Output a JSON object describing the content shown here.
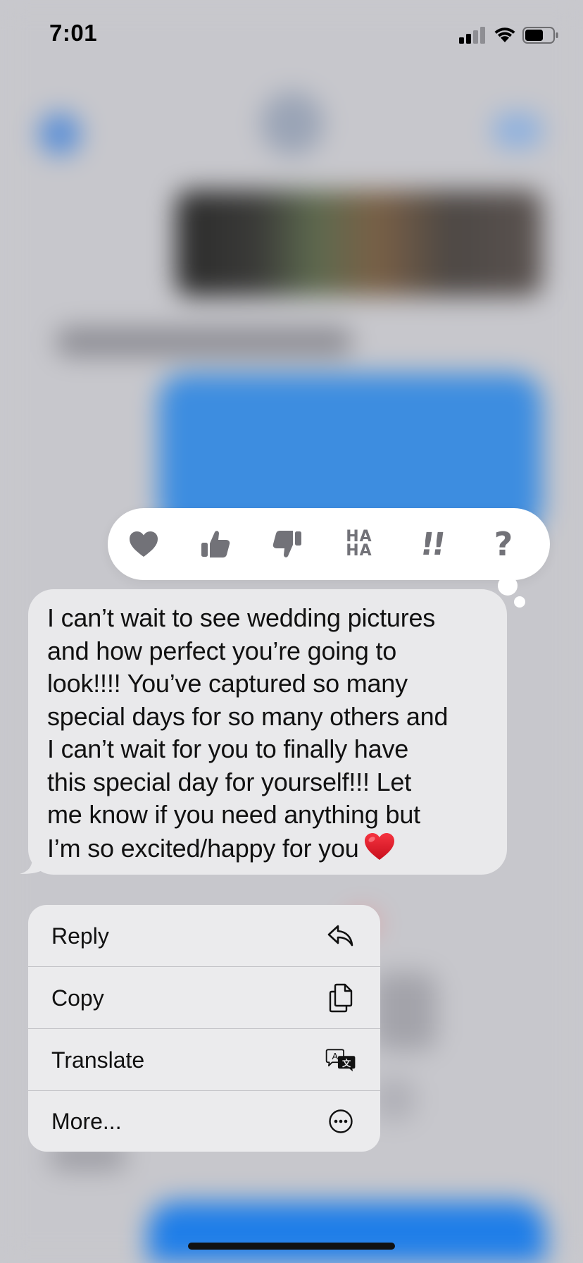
{
  "status_bar": {
    "time": "7:01",
    "signal_icon": "cellular-signal-icon",
    "wifi_icon": "wifi-icon",
    "battery_icon": "battery-icon"
  },
  "tapbacks": [
    {
      "name": "heart",
      "icon": "heart-icon"
    },
    {
      "name": "thumbs-up",
      "icon": "thumbs-up-icon"
    },
    {
      "name": "thumbs-down",
      "icon": "thumbs-down-icon"
    },
    {
      "name": "haha",
      "text": "HA\nHA"
    },
    {
      "name": "exclamation",
      "text": "!!"
    },
    {
      "name": "question",
      "text": "?"
    }
  ],
  "message": {
    "text": "I can’t wait to see wedding pictures\nand how perfect you’re going to\nlook!!!! You’ve captured so many\nspecial days for so many others and\nI can’t wait for you to finally have\nthis special day for yourself!!! Let\nme know if you need anything but\nI’m so excited/happy for you",
    "emoji": "red-heart-emoji"
  },
  "menu": {
    "items": [
      {
        "label": "Reply",
        "icon": "reply-arrow-icon"
      },
      {
        "label": "Copy",
        "icon": "copy-icon"
      },
      {
        "label": "Translate",
        "icon": "translate-icon"
      },
      {
        "label": "More...",
        "icon": "more-ellipsis-icon"
      }
    ]
  },
  "colors": {
    "bubble_bg": "#e9e9eb",
    "menu_bg": "#ebebed",
    "tapback_icon": "#727278",
    "heart": "#e0202e"
  }
}
